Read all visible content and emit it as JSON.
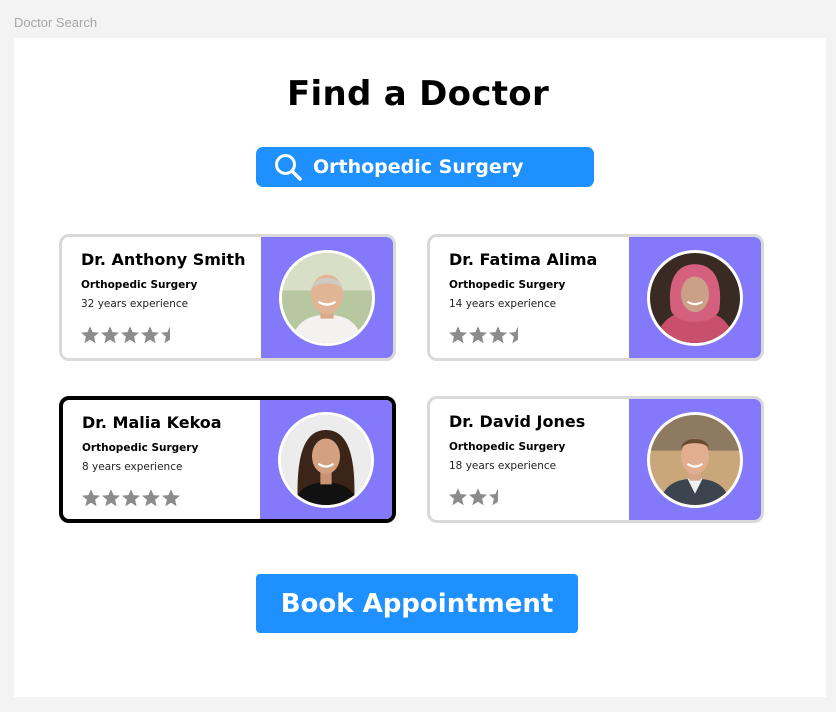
{
  "window": {
    "title": "Doctor Search"
  },
  "page": {
    "title": "Find a Doctor"
  },
  "search": {
    "value": "Orthopedic Surgery",
    "icon": "search-icon"
  },
  "doctors": [
    {
      "name": "Dr. Anthony Smith",
      "specialty": "Orthopedic Surgery",
      "experience": "32 years experience",
      "rating": 4.5,
      "selected": false
    },
    {
      "name": "Dr. Fatima Alima",
      "specialty": "Orthopedic Surgery",
      "experience": "14 years experience",
      "rating": 3.5,
      "selected": false
    },
    {
      "name": "Dr. Malia Kekoa",
      "specialty": "Orthopedic Surgery",
      "experience": "8 years experience",
      "rating": 5,
      "selected": true
    },
    {
      "name": "Dr. David Jones",
      "specialty": "Orthopedic Surgery",
      "experience": "18 years experience",
      "rating": 2.5,
      "selected": false
    }
  ],
  "actions": {
    "book_label": "Book Appointment"
  },
  "colors": {
    "accent": "#1e90ff",
    "photo_panel": "#8479fb",
    "star": "#8c8c8c",
    "card_border": "#d9d9d9",
    "selected_border": "#000000"
  }
}
